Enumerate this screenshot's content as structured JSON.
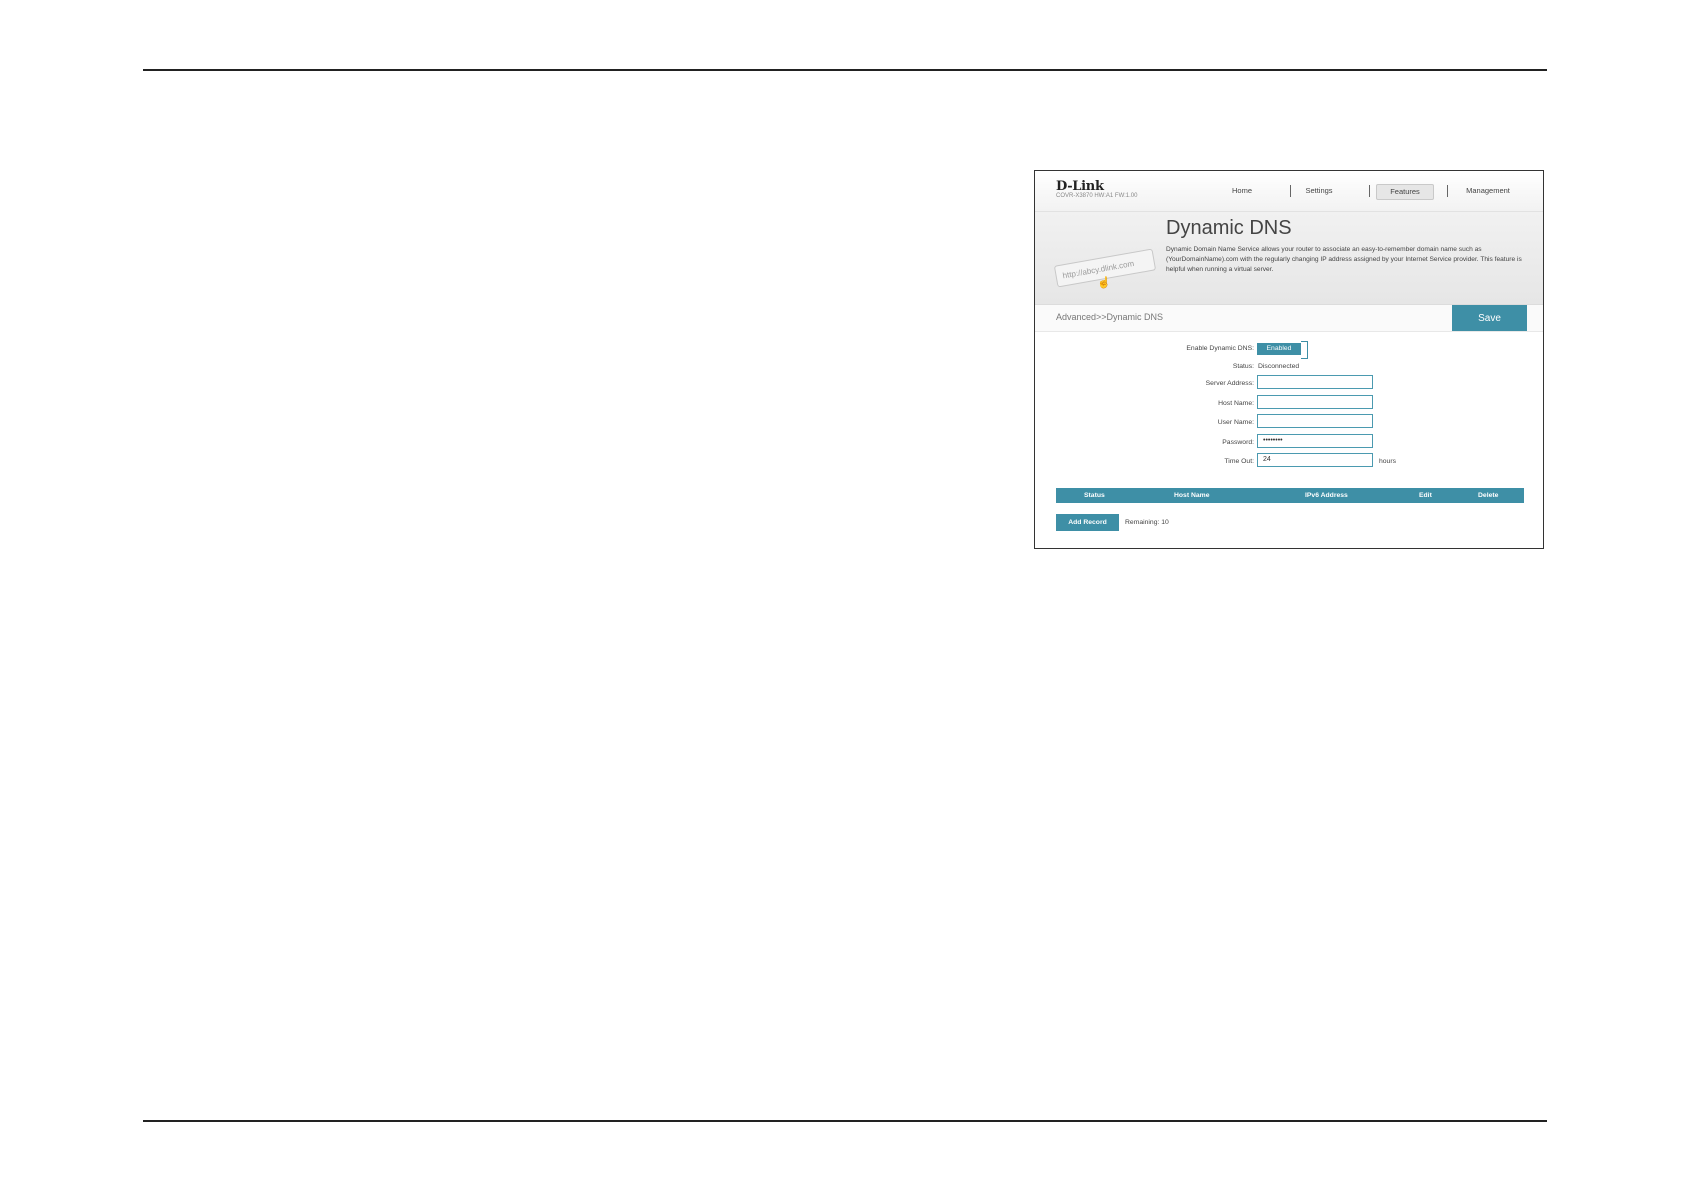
{
  "router_ui": {
    "brand": "D-Link",
    "model_info": "COVR-X3870 HW:A1 FW:1.00",
    "nav": [
      {
        "label": "Home"
      },
      {
        "label": "Settings"
      },
      {
        "label": "Features",
        "active": true
      },
      {
        "label": "Management"
      }
    ],
    "banner": {
      "title": "Dynamic DNS",
      "description": "Dynamic Domain Name Service allows your router to associate an easy-to-remember domain name such as (YourDomainName).com with the regularly changing IP address assigned by your Internet Service provider. This feature is helpful when running a virtual server.",
      "art_text": "http://abcy.dlink.com"
    },
    "breadcrumb": "Advanced>>Dynamic DNS",
    "save_label": "Save",
    "form": {
      "enable_label": "Enable Dynamic DNS:",
      "enable_value": "Enabled",
      "status_label": "Status:",
      "status_value": "Disconnected",
      "server_label": "Server Address:",
      "server_value": "",
      "host_label": "Host Name:",
      "host_value": "",
      "user_label": "User Name:",
      "user_value": "",
      "password_label": "Password:",
      "password_value": "••••••••",
      "timeout_label": "Time Out:",
      "timeout_value": "24",
      "timeout_unit": "hours"
    },
    "table": {
      "columns": [
        "Status",
        "Host Name",
        "IPv6 Address",
        "Edit",
        "Delete"
      ]
    },
    "add_record_label": "Add Record",
    "remaining": "Remaining: 10"
  },
  "colors": {
    "accent": "#3e8fa6",
    "rule": "#222222"
  }
}
